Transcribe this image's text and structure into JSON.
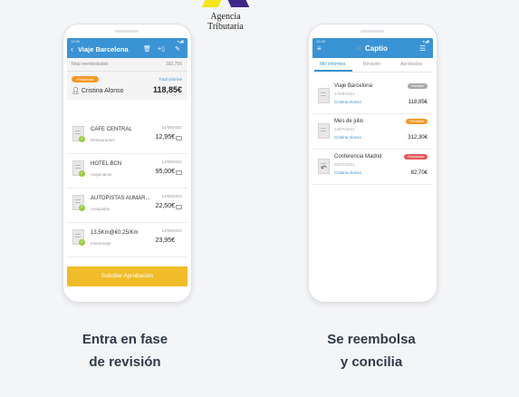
{
  "logo": {
    "text": "Agencia Tributaria",
    "colors": [
      "#f5e51c",
      "#3e2787"
    ]
  },
  "left_phone": {
    "status_time": "12:30",
    "title": "Viaje Barcelona",
    "total_label": "Total reembolsable",
    "total_top": "182,75€",
    "badge": "Pendiente",
    "total_informe_label": "Total informe",
    "person": "Cristina Alonso",
    "total": "118,85€",
    "expenses": [
      {
        "name": "CAFE CENTRAL",
        "category": "Restaurantes",
        "date": "14/08/2021",
        "amount": "12,95€"
      },
      {
        "name": "HOTEL BCN",
        "category": "Alojamiento",
        "date": "14/08/2021",
        "amount": "95,00€"
      },
      {
        "name": "AUTOPISTAS AUMAR...",
        "category": "Autopistas",
        "date": "14/08/2021",
        "amount": "22,50€"
      },
      {
        "name": "13,5Km@€0,25/Km",
        "category": "Kilometraje",
        "date": "14/08/2021",
        "amount": "23,95€"
      }
    ],
    "cta": "Solicitar Aprobación"
  },
  "right_phone": {
    "status_time": "12:30",
    "app_name": "Captio",
    "tabs": [
      "Mis informes",
      "Revisión",
      "Aprobados"
    ],
    "reports": [
      {
        "name": "Viaje Barcelona",
        "date": "17/08/2021",
        "person": "Cristina Alonso",
        "status": "Borrador",
        "status_color": "#a9a9a9",
        "amount": "118,85€"
      },
      {
        "name": "Mes de julio",
        "date": "13/07/2021",
        "person": "Cristina Alonso",
        "status": "Pendiente",
        "status_color": "#f39a2b",
        "amount": "312,30€"
      },
      {
        "name": "Conferencia Madrid",
        "date": "02/07/2021",
        "person": "Cristina Alonso",
        "status": "Rechazado",
        "status_color": "#e35a5a",
        "amount": "82,70€"
      }
    ]
  },
  "captions": {
    "left": [
      "Entra en fase",
      "de revisión"
    ],
    "right": [
      "Se reembolsa",
      "y concilia"
    ]
  },
  "colors": {
    "primary": "#3a93d4",
    "cta": "#f0bc2a",
    "approved": "#9ccc3b"
  }
}
